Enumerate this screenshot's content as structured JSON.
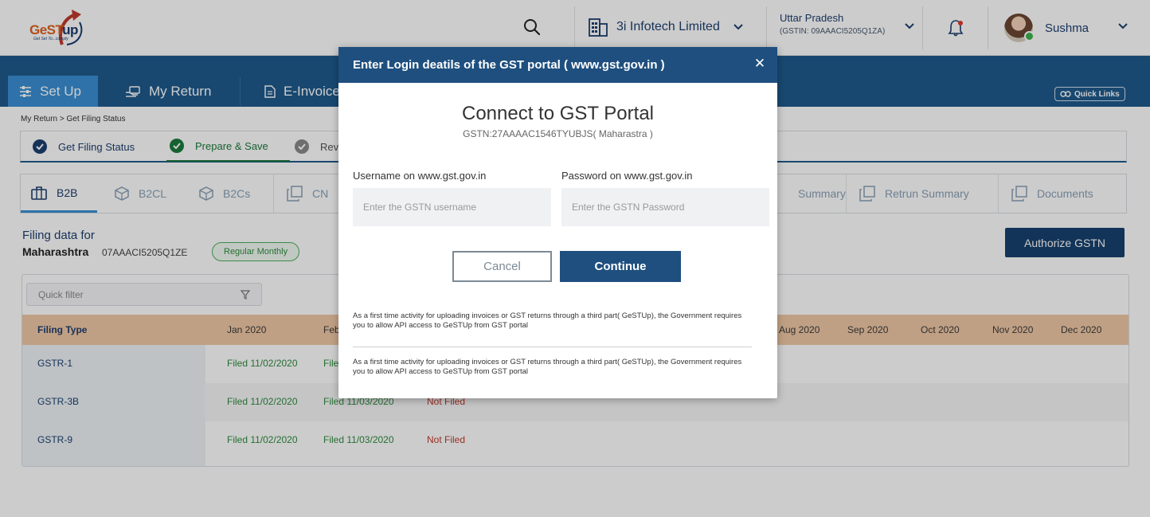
{
  "header": {
    "logo": {
      "brand_main": "GeST",
      "brand_accent": "up",
      "tagline": "Get Set To...comply"
    },
    "company_name": "3i Infotech Limited",
    "state_name": "Uttar Pradesh",
    "state_gstin": "(GSTIN: 09AAACI5205Q1ZA)",
    "user_name": "Sushma"
  },
  "nav": {
    "tabs": [
      {
        "label": "Set Up",
        "active": true
      },
      {
        "label": "My Return",
        "active": false
      },
      {
        "label": "E-Invoice",
        "active": false
      }
    ],
    "quick_links": "Quick Links"
  },
  "breadcrumb": "My Return > Get Filing Status",
  "steps": [
    {
      "label": "Get Filing Status"
    },
    {
      "label": "Prepare & Save"
    },
    {
      "label": "Rev"
    }
  ],
  "subtabs": [
    {
      "label": "B2B"
    },
    {
      "label": "B2CL"
    },
    {
      "label": "B2Cs"
    },
    {
      "label": "CN"
    },
    {
      "label": "Summary"
    },
    {
      "label": "Retrun Summary"
    },
    {
      "label": "Documents"
    }
  ],
  "filing": {
    "label": "Filing data for",
    "state": "Maharashtra",
    "gstin": "07AAACI5205Q1ZE",
    "badge": "Regular Monthly",
    "authorize_button": "Authorize GSTN"
  },
  "table": {
    "quick_filter_placeholder": "Quick filter",
    "headers": [
      "Filing Type",
      "Jan 2020",
      "Feb",
      "Aug 2020",
      "Sep  2020",
      "Oct  2020",
      "Nov  2020",
      "Dec 2020"
    ],
    "rows": [
      {
        "type": "GSTR-1",
        "jan": "Filed 11/02/2020",
        "feb": "Filed",
        "mar": ""
      },
      {
        "type": "GSTR-3B",
        "jan": "Filed 11/02/2020",
        "feb": "Filed 11/03/2020",
        "mar": "Not Filed"
      },
      {
        "type": "GSTR-9",
        "jan": "Filed 11/02/2020",
        "feb": "Filed 11/03/2020",
        "mar": "Not Filed"
      }
    ]
  },
  "modal": {
    "header": "Enter Login deatils of the GST portal ( www.gst.gov.in )",
    "title": "Connect to GST Portal",
    "subtitle": "GSTN:27AAAAC1546TYUBJS( Maharastra )",
    "username_label": "Username on www.gst.gov.in",
    "username_placeholder": "Enter the GSTN username",
    "password_label": "Password on www.gst.gov.in",
    "password_placeholder": "Enter the GSTN Password",
    "cancel": "Cancel",
    "continue": "Continue",
    "note1": "As a first time activity for uploading invoices or GST returns through a third part( GeSTUp), the Government requires you to allow API access to GeSTUp from GST portal",
    "note2": "As a first time activity for uploading invoices or GST returns through a third part( GeSTUp), the Government requires you to allow API access to GeSTUp from GST portal"
  },
  "colors": {
    "primary": "#1e4f7f",
    "nav_blue": "#1e5a8c",
    "active_tab": "#3a8fd4",
    "filed_green": "#2e8b3e",
    "not_filed_red": "#c0392b",
    "table_header": "#f1c9a6"
  },
  "icons": [
    "search-icon",
    "building-icon",
    "chevron-down-icon",
    "bell-icon",
    "sliders-icon",
    "hand-money-icon",
    "document-icon",
    "link-icon",
    "check-circle-icon",
    "briefcase-icon",
    "box-icon",
    "copy-icon",
    "funnel-icon",
    "close-icon"
  ]
}
